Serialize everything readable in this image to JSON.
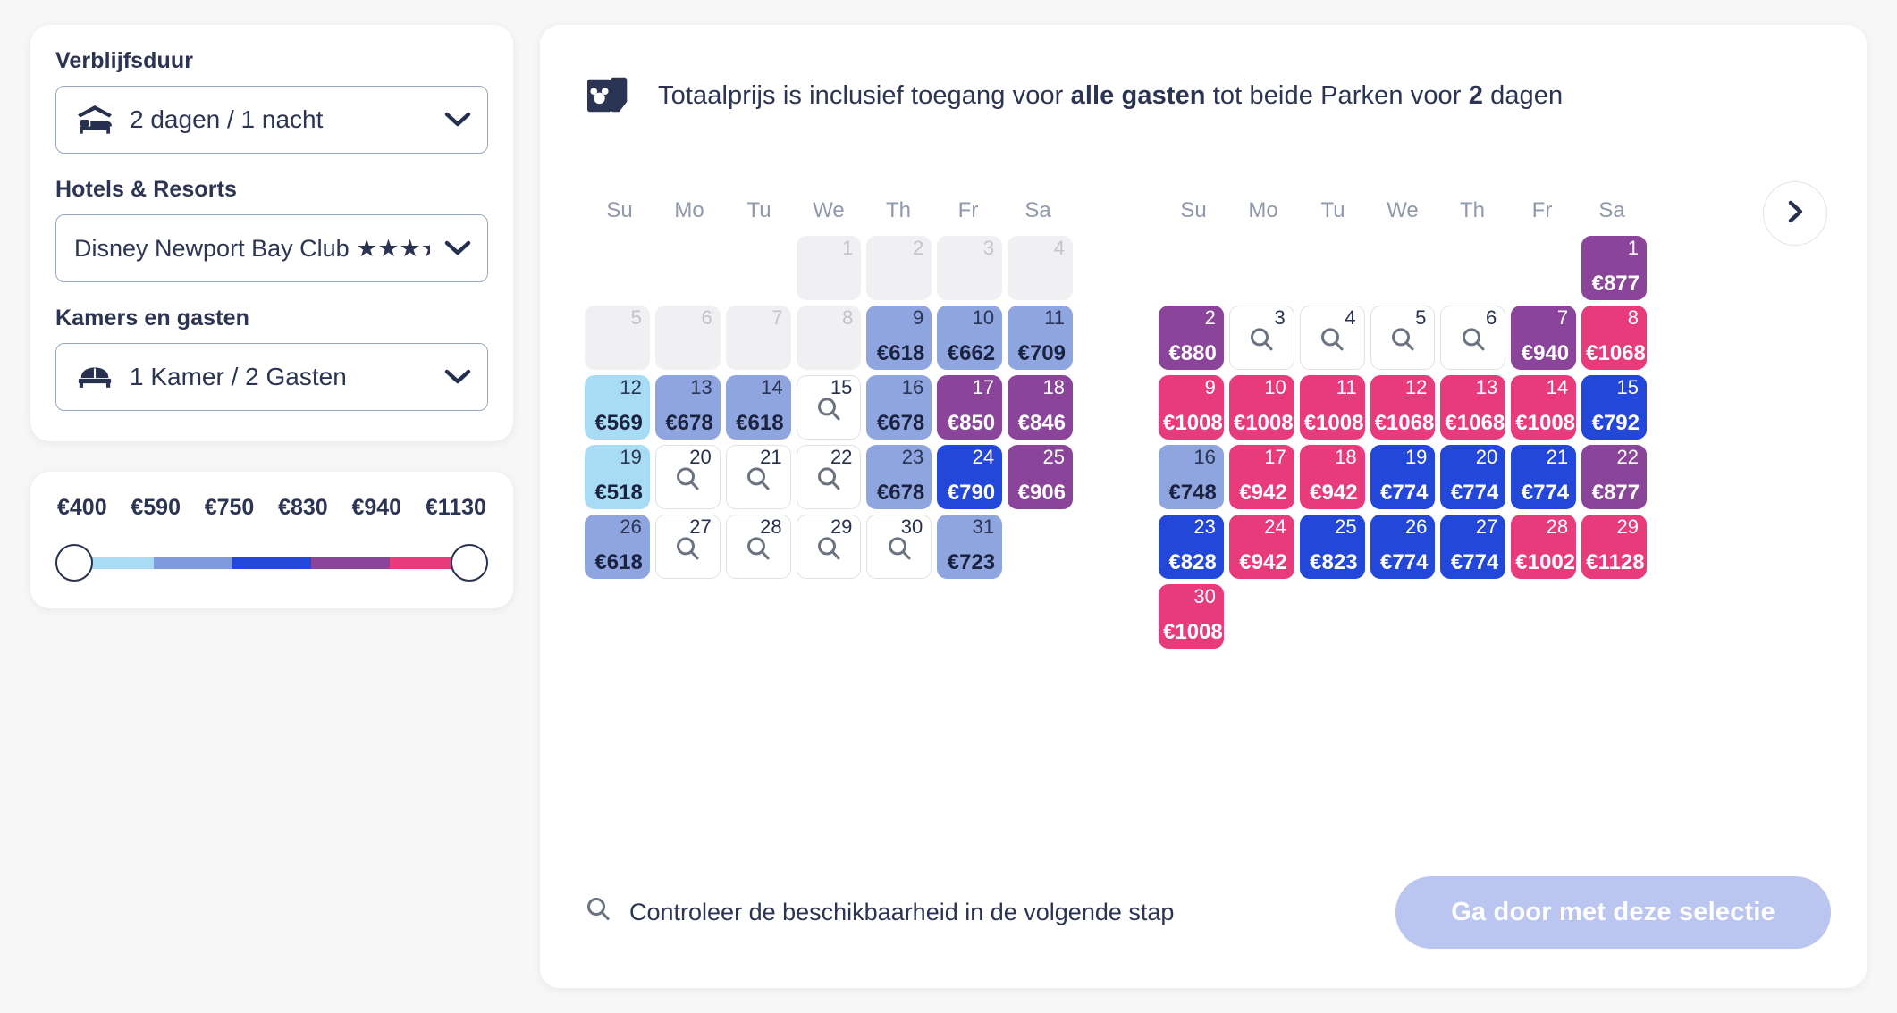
{
  "sidebar": {
    "duration": {
      "label": "Verblijfsduur",
      "value": "2 dagen / 1 nacht",
      "icon": "hotel-bed-icon"
    },
    "hotel": {
      "label": "Hotels & Resorts",
      "value": "Disney Newport Bay Club ★★★★"
    },
    "rooms": {
      "label": "Kamers en gasten",
      "value": "1 Kamer / 2 Gasten",
      "icon": "bed-icon"
    },
    "price_slider": {
      "ticks": [
        "€400",
        "€590",
        "€750",
        "€830",
        "€940",
        "€1130"
      ],
      "min_value": "€400",
      "max_value": "€1130",
      "segment_colors": [
        "#a8dcf5",
        "#7e9cdd",
        "#2347d8",
        "#8a4499",
        "#e83b7c"
      ]
    }
  },
  "banner": {
    "icon": "park-ticket-icon",
    "prefix": "Totaalprijs is inclusief toegang voor ",
    "bold1": "alle gasten",
    "middle": " tot beide Parken voor ",
    "bold2": "2",
    "suffix": " dagen"
  },
  "nav": {
    "next_label": "chevron-right-icon"
  },
  "colors": {
    "tier_lightblue": "#a8dcf5",
    "tier_periwinkle": "#8fa5e0",
    "tier_blue": "#2347d8",
    "tier_purple": "#8a4499",
    "tier_pink": "#e83b7c",
    "past": "#f0f0f2",
    "text_dark": "#2b3453",
    "cta_bg": "#bac5f0"
  },
  "calendar": {
    "dow": [
      "Su",
      "Mo",
      "Tu",
      "We",
      "Th",
      "Fr",
      "Sa"
    ],
    "months": [
      {
        "lead_blanks": 3,
        "days": [
          {
            "d": "1",
            "state": "past"
          },
          {
            "d": "2",
            "state": "past"
          },
          {
            "d": "3",
            "state": "past"
          },
          {
            "d": "4",
            "state": "past"
          },
          {
            "d": "5",
            "state": "past"
          },
          {
            "d": "6",
            "state": "past"
          },
          {
            "d": "7",
            "state": "past"
          },
          {
            "d": "8",
            "state": "past"
          },
          {
            "d": "9",
            "state": "priced",
            "p": "€618",
            "color": "#8fa5e0",
            "light": true
          },
          {
            "d": "10",
            "state": "priced",
            "p": "€662",
            "color": "#8fa5e0",
            "light": true
          },
          {
            "d": "11",
            "state": "priced",
            "p": "€709",
            "color": "#8fa5e0",
            "light": true
          },
          {
            "d": "12",
            "state": "priced",
            "p": "€569",
            "color": "#a8dcf5",
            "light": true
          },
          {
            "d": "13",
            "state": "priced",
            "p": "€678",
            "color": "#8fa5e0",
            "light": true
          },
          {
            "d": "14",
            "state": "priced",
            "p": "€618",
            "color": "#8fa5e0",
            "light": true
          },
          {
            "d": "15",
            "state": "avail"
          },
          {
            "d": "16",
            "state": "priced",
            "p": "€678",
            "color": "#8fa5e0",
            "light": true
          },
          {
            "d": "17",
            "state": "priced",
            "p": "€850",
            "color": "#8a4499",
            "light": false
          },
          {
            "d": "18",
            "state": "priced",
            "p": "€846",
            "color": "#8a4499",
            "light": false
          },
          {
            "d": "19",
            "state": "priced",
            "p": "€518",
            "color": "#a8dcf5",
            "light": true
          },
          {
            "d": "20",
            "state": "avail"
          },
          {
            "d": "21",
            "state": "avail"
          },
          {
            "d": "22",
            "state": "avail"
          },
          {
            "d": "23",
            "state": "priced",
            "p": "€678",
            "color": "#8fa5e0",
            "light": true
          },
          {
            "d": "24",
            "state": "priced",
            "p": "€790",
            "color": "#2347d8",
            "light": false
          },
          {
            "d": "25",
            "state": "priced",
            "p": "€906",
            "color": "#8a4499",
            "light": false
          },
          {
            "d": "26",
            "state": "priced",
            "p": "€618",
            "color": "#8fa5e0",
            "light": true
          },
          {
            "d": "27",
            "state": "avail"
          },
          {
            "d": "28",
            "state": "avail"
          },
          {
            "d": "29",
            "state": "avail"
          },
          {
            "d": "30",
            "state": "avail"
          },
          {
            "d": "31",
            "state": "priced",
            "p": "€723",
            "color": "#8fa5e0",
            "light": true
          }
        ]
      },
      {
        "lead_blanks": 6,
        "days": [
          {
            "d": "1",
            "state": "priced",
            "p": "€877",
            "color": "#8a4499",
            "light": false
          },
          {
            "d": "2",
            "state": "priced",
            "p": "€880",
            "color": "#8a4499",
            "light": false
          },
          {
            "d": "3",
            "state": "avail"
          },
          {
            "d": "4",
            "state": "avail"
          },
          {
            "d": "5",
            "state": "avail"
          },
          {
            "d": "6",
            "state": "avail"
          },
          {
            "d": "7",
            "state": "priced",
            "p": "€940",
            "color": "#8a4499",
            "light": false
          },
          {
            "d": "8",
            "state": "priced",
            "p": "€1068",
            "color": "#e83b7c",
            "light": false
          },
          {
            "d": "9",
            "state": "priced",
            "p": "€1008",
            "color": "#e83b7c",
            "light": false
          },
          {
            "d": "10",
            "state": "priced",
            "p": "€1008",
            "color": "#e83b7c",
            "light": false
          },
          {
            "d": "11",
            "state": "priced",
            "p": "€1008",
            "color": "#e83b7c",
            "light": false
          },
          {
            "d": "12",
            "state": "priced",
            "p": "€1068",
            "color": "#e83b7c",
            "light": false
          },
          {
            "d": "13",
            "state": "priced",
            "p": "€1068",
            "color": "#e83b7c",
            "light": false
          },
          {
            "d": "14",
            "state": "priced",
            "p": "€1008",
            "color": "#e83b7c",
            "light": false
          },
          {
            "d": "15",
            "state": "priced",
            "p": "€792",
            "color": "#2347d8",
            "light": false
          },
          {
            "d": "16",
            "state": "priced",
            "p": "€748",
            "color": "#8fa5e0",
            "light": true
          },
          {
            "d": "17",
            "state": "priced",
            "p": "€942",
            "color": "#e83b7c",
            "light": false
          },
          {
            "d": "18",
            "state": "priced",
            "p": "€942",
            "color": "#e83b7c",
            "light": false
          },
          {
            "d": "19",
            "state": "priced",
            "p": "€774",
            "color": "#2347d8",
            "light": false
          },
          {
            "d": "20",
            "state": "priced",
            "p": "€774",
            "color": "#2347d8",
            "light": false
          },
          {
            "d": "21",
            "state": "priced",
            "p": "€774",
            "color": "#2347d8",
            "light": false
          },
          {
            "d": "22",
            "state": "priced",
            "p": "€877",
            "color": "#8a4499",
            "light": false
          },
          {
            "d": "23",
            "state": "priced",
            "p": "€828",
            "color": "#2347d8",
            "light": false
          },
          {
            "d": "24",
            "state": "priced",
            "p": "€942",
            "color": "#e83b7c",
            "light": false
          },
          {
            "d": "25",
            "state": "priced",
            "p": "€823",
            "color": "#2347d8",
            "light": false
          },
          {
            "d": "26",
            "state": "priced",
            "p": "€774",
            "color": "#2347d8",
            "light": false
          },
          {
            "d": "27",
            "state": "priced",
            "p": "€774",
            "color": "#2347d8",
            "light": false
          },
          {
            "d": "28",
            "state": "priced",
            "p": "€1002",
            "color": "#e83b7c",
            "light": false
          },
          {
            "d": "29",
            "state": "priced",
            "p": "€1128",
            "color": "#e83b7c",
            "light": false
          },
          {
            "d": "30",
            "state": "priced",
            "p": "€1008",
            "color": "#e83b7c",
            "light": false
          }
        ]
      }
    ]
  },
  "footer": {
    "hint_icon": "magnifier-icon",
    "hint": "Controleer de beschikbaarheid in de volgende stap",
    "cta_label": "Ga door met deze selectie"
  }
}
